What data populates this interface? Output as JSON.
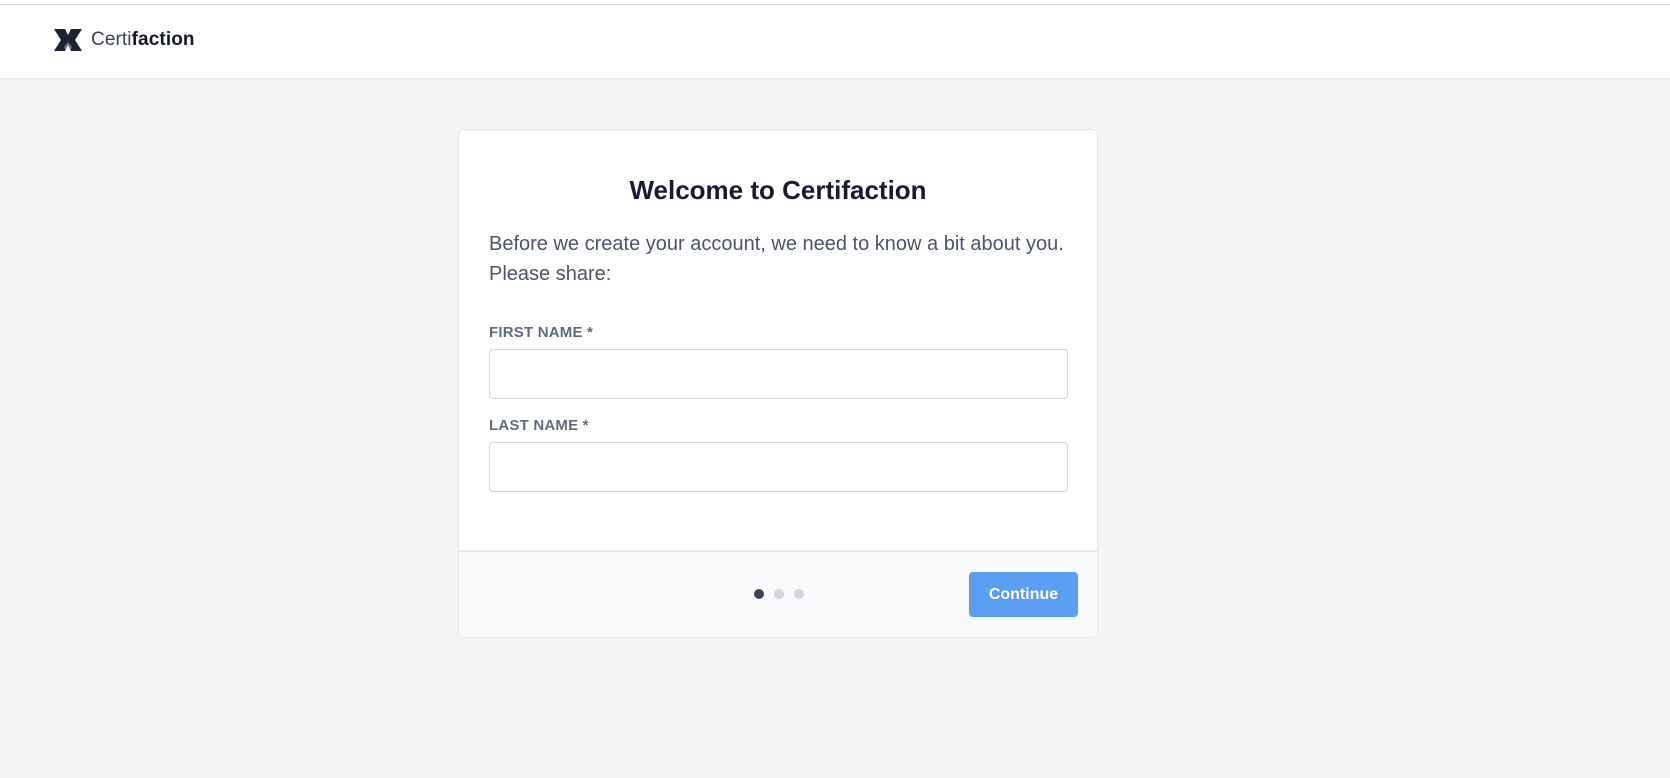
{
  "header": {
    "brand_light": "Certi",
    "brand_bold": "faction",
    "logo_icon": "certifaction-logo-icon"
  },
  "card": {
    "title": "Welcome to Certifaction",
    "intro": "Before we create your account, we need to know a bit about you. Please share:",
    "fields": [
      {
        "label": "FIRST NAME *",
        "value": "",
        "placeholder": ""
      },
      {
        "label": "LAST NAME *",
        "value": "",
        "placeholder": ""
      }
    ],
    "steps": {
      "current": 1,
      "total": 3
    },
    "continue_label": "Continue"
  },
  "colors": {
    "accent": "#5b9ef1",
    "page_background": "#f3f4f6",
    "active_step": "#3c4454",
    "inactive_step": "#d1d5db"
  }
}
